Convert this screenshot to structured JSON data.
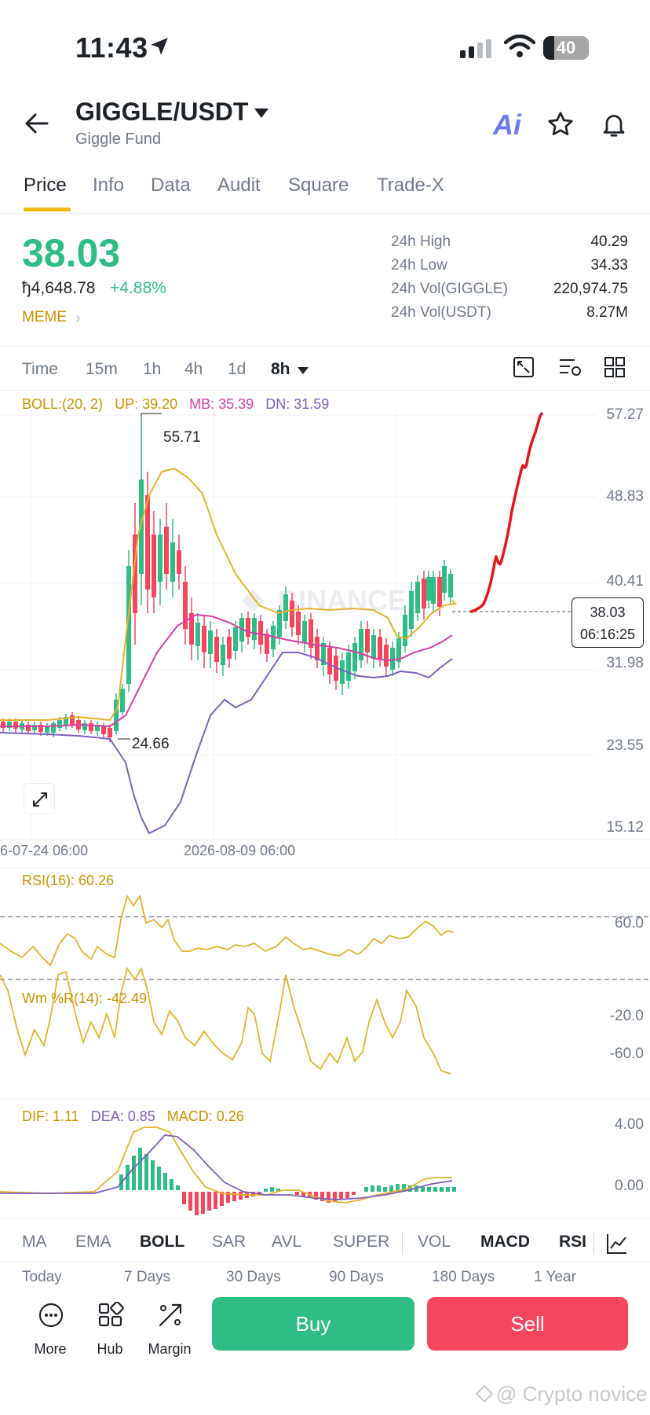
{
  "status_bar": {
    "time": "11:43",
    "battery": "40"
  },
  "header": {
    "pair": "GIGGLE/USDT",
    "subtitle": "Giggle Fund",
    "ai_label": "Ai"
  },
  "tabs": [
    {
      "label": "Price",
      "active": true
    },
    {
      "label": "Info"
    },
    {
      "label": "Data"
    },
    {
      "label": "Audit"
    },
    {
      "label": "Square"
    },
    {
      "label": "Trade-X"
    }
  ],
  "price": {
    "last": "38.03",
    "fiat": "ђ4,648.78",
    "change": "+4.88%",
    "tag": "MEME"
  },
  "stats": [
    {
      "label": "24h High",
      "value": "40.29"
    },
    {
      "label": "24h Low",
      "value": "34.33"
    },
    {
      "label": "24h Vol(GIGGLE)",
      "value": "220,974.75"
    },
    {
      "label": "24h Vol(USDT)",
      "value": "8.27M"
    }
  ],
  "timeframes": [
    "Time",
    "15m",
    "1h",
    "4h",
    "1d",
    "8h"
  ],
  "active_timeframe": "8h",
  "boll": {
    "params": "BOLL:(20, 2)",
    "up": "UP: 39.20",
    "mb": "MB: 35.39",
    "dn": "DN: 31.59"
  },
  "price_axis": [
    "57.27",
    "48.83",
    "40.41",
    "31.98",
    "23.55",
    "15.12"
  ],
  "annotations": {
    "high": "55.71",
    "low": "24.66"
  },
  "last_price_box": {
    "price": "38.03",
    "countdown": "06:16:25"
  },
  "dates": [
    "6-07-24 06:00",
    "2026-08-09 06:00"
  ],
  "watermark": "BINANCE",
  "rsi": {
    "label": "RSI(16): 60.26",
    "axis": "60.0"
  },
  "wr": {
    "label": "Wm %R(14): -42.49",
    "axis_top": "-20.0",
    "axis_bottom": "-60.0"
  },
  "macd": {
    "dif": "DIF: 1.11",
    "dea": "DEA: 0.85",
    "macd": "MACD: 0.26",
    "axis_top": "4.00",
    "axis_bottom": "0.00"
  },
  "indicators": [
    "MA",
    "EMA",
    "BOLL",
    "SAR",
    "AVL",
    "SUPER",
    "VOL",
    "MACD",
    "RSI"
  ],
  "active_indicators": [
    "BOLL",
    "MACD",
    "RSI"
  ],
  "periods": [
    "Today",
    "7 Days",
    "30 Days",
    "90 Days",
    "180 Days",
    "1 Year"
  ],
  "bottom_nav": [
    "More",
    "Hub",
    "Margin"
  ],
  "actions": {
    "buy": "Buy",
    "sell": "Sell"
  },
  "credit": "@ Crypto novice",
  "colors": {
    "up": "#2ebd85",
    "down": "#f6465d",
    "boll_up": "#e5b32a",
    "boll_mb": "#d63fa4",
    "boll_dn": "#7f5fbf",
    "accent": "#f0b90b",
    "drawing": "#e8141b"
  }
}
